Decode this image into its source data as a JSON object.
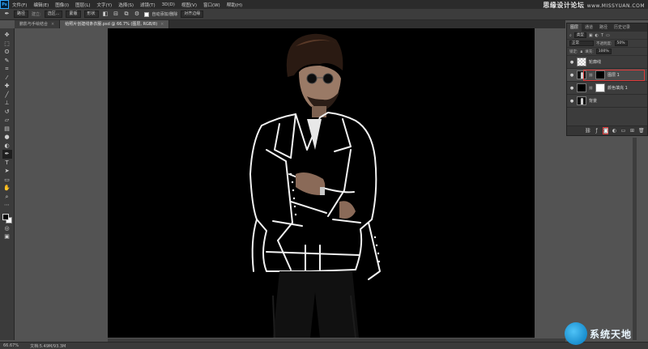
{
  "app": {
    "logo": "Ps"
  },
  "menu": [
    "文件(F)",
    "编辑(E)",
    "图像(I)",
    "图层(L)",
    "文字(Y)",
    "选择(S)",
    "滤镜(T)",
    "3D(D)",
    "视图(V)",
    "窗口(W)",
    "帮助(H)"
  ],
  "watermark_top": {
    "main": "思缘设计论坛",
    "sub": "www.MISSYUAN.COM"
  },
  "options": {
    "mode": "路径",
    "make_label": "建立:",
    "selection": "选区...",
    "mask": "蒙版",
    "shape": "形状",
    "auto_label": "自动添加/删除",
    "align": "对齐边缘"
  },
  "tabs": [
    {
      "title": "鹏影与手绘结合",
      "active": false
    },
    {
      "title": "给照片创建线条衣服.psd @ 66.7% (图层, RGB/8)",
      "active": true
    }
  ],
  "tools": [
    "move-icon",
    "marquee-icon",
    "lasso-icon",
    "quick-select-icon",
    "crop-icon",
    "eyedropper-icon",
    "healing-icon",
    "brush-icon",
    "stamp-icon",
    "history-brush-icon",
    "eraser-icon",
    "gradient-icon",
    "blur-icon",
    "dodge-icon",
    "pen-icon",
    "type-icon",
    "path-select-icon",
    "rectangle-icon",
    "hand-icon",
    "zoom-icon",
    "more-icon"
  ],
  "panel": {
    "tabs": [
      "图层",
      "通道",
      "路径",
      "历史记录"
    ],
    "filter_label": "类型",
    "blend_mode": "正常",
    "opacity_label": "不透明度:",
    "opacity": "50%",
    "lock_label": "锁定:",
    "fill_label": "填充:",
    "fill": "100%",
    "layers": [
      {
        "name": "轮廓线",
        "thumb": "checker",
        "visible": true,
        "selected": false,
        "mask": false
      },
      {
        "name": "图层 1",
        "thumb": "person",
        "visible": true,
        "selected": true,
        "mask": true
      },
      {
        "name": "颜色填充 1",
        "thumb": "black",
        "visible": true,
        "selected": false,
        "mask": "white"
      },
      {
        "name": "背景",
        "thumb": "person",
        "visible": true,
        "selected": false,
        "mask": false
      }
    ]
  },
  "status": {
    "zoom": "66.67%",
    "doc": "文档:5.49M/93.3M"
  },
  "watermark_bottom": "系统天地"
}
